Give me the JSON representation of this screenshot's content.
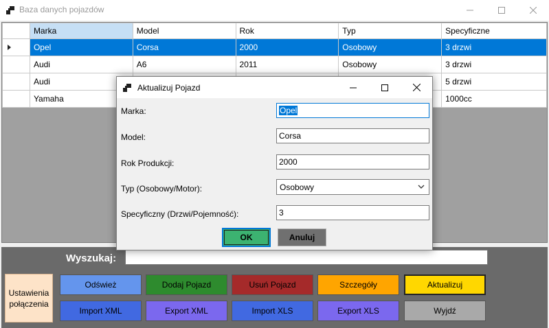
{
  "window": {
    "title": "Baza danych pojazdów"
  },
  "grid": {
    "columns": [
      "Marka",
      "Model",
      "Rok",
      "Typ",
      "Specyficzne"
    ],
    "rows": [
      [
        "Opel",
        "Corsa",
        "2000",
        "Osobowy",
        "3 drzwi"
      ],
      [
        "Audi",
        "A6",
        "2011",
        "Osobowy",
        "3 drzwi"
      ],
      [
        "Audi",
        "",
        "",
        "",
        "5 drzwi"
      ],
      [
        "Yamaha",
        "",
        "",
        "",
        "1000cc"
      ]
    ]
  },
  "bottom": {
    "search_label": "Wyszukaj:",
    "search_value": "",
    "connection_settings_label": "Ustawienia połączenia",
    "buttons": {
      "refresh": "Odśwież",
      "add": "Dodaj Pojazd",
      "delete": "Usuń Pojazd",
      "details": "Szczegóły",
      "update": "Aktualizuj",
      "import_xml": "Import XML",
      "export_xml": "Export XML",
      "import_xls": "Import XLS",
      "export_xls": "Export XLS",
      "exit": "Wyjdź"
    },
    "colors": {
      "refresh": "#6495ed",
      "add": "#2e8b2e",
      "delete": "#a52a2a",
      "details": "#ffa500",
      "update": "#ffd700",
      "import_xml": "#4169e1",
      "export_xml": "#7b68ee",
      "import_xls": "#4169e1",
      "export_xls": "#7b68ee",
      "exit": "#a9a9a9"
    }
  },
  "dialog": {
    "title": "Aktualizuj Pojazd",
    "fields": {
      "make_label": "Marka:",
      "make_value": "Opel",
      "model_label": "Model:",
      "model_value": "Corsa",
      "year_label": "Rok Produkcji:",
      "year_value": "2000",
      "type_label": "Typ (Osobowy/Motor):",
      "type_value": "Osobowy",
      "specific_label": "Specyficzny (Drzwi/Pojemność):",
      "specific_value": "3"
    },
    "ok_label": "OK",
    "cancel_label": "Anuluj"
  }
}
